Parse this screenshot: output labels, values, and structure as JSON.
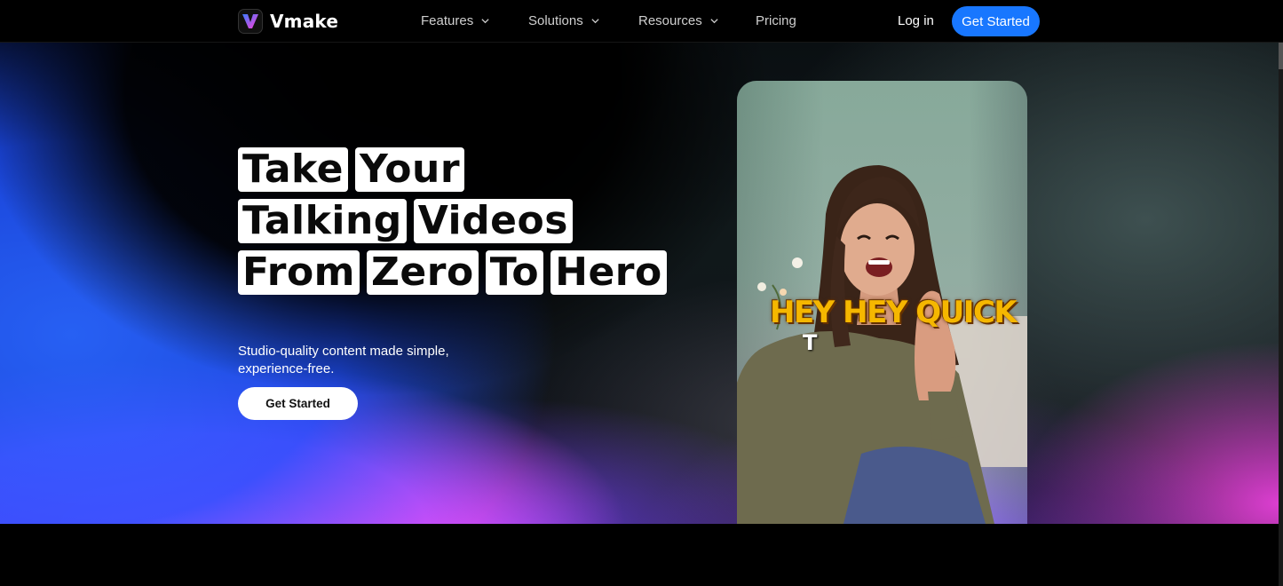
{
  "brand": {
    "name": "Vmake"
  },
  "nav": {
    "items": [
      {
        "label": "Features",
        "has_dropdown": true
      },
      {
        "label": "Solutions",
        "has_dropdown": true
      },
      {
        "label": "Resources",
        "has_dropdown": true
      },
      {
        "label": "Pricing",
        "has_dropdown": false
      }
    ],
    "login_label": "Log in",
    "cta_label": "Get Started"
  },
  "hero": {
    "headline_rows": [
      [
        "Take",
        "Your"
      ],
      [
        "Talking",
        "Videos"
      ],
      [
        "From",
        "Zero",
        "To",
        "Hero"
      ]
    ],
    "subtitle_line1": "Studio-quality content made simple,",
    "subtitle_line2": "experience-free.",
    "cta_label": "Get Started"
  },
  "video": {
    "caption": "HEY HEY QUICK",
    "caption_sub": "T"
  },
  "colors": {
    "accent": "#1877ff",
    "nav_bg": "#000000",
    "caption": "#f5b700"
  }
}
